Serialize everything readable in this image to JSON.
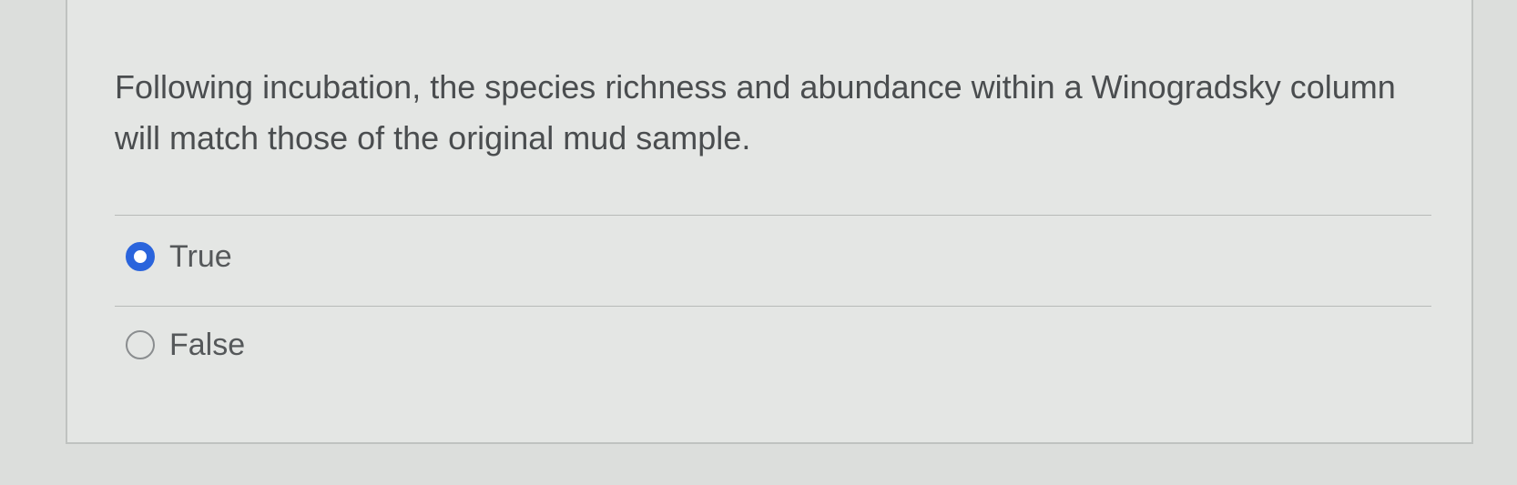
{
  "question": {
    "text": "Following incubation, the species richness and abundance within a Winogradsky column will match those of the original mud sample."
  },
  "options": [
    {
      "label": "True",
      "selected": true
    },
    {
      "label": "False",
      "selected": false
    }
  ],
  "colors": {
    "accent": "#2a64dc",
    "text": "#4a4d4f",
    "background": "#e4e6e4"
  }
}
